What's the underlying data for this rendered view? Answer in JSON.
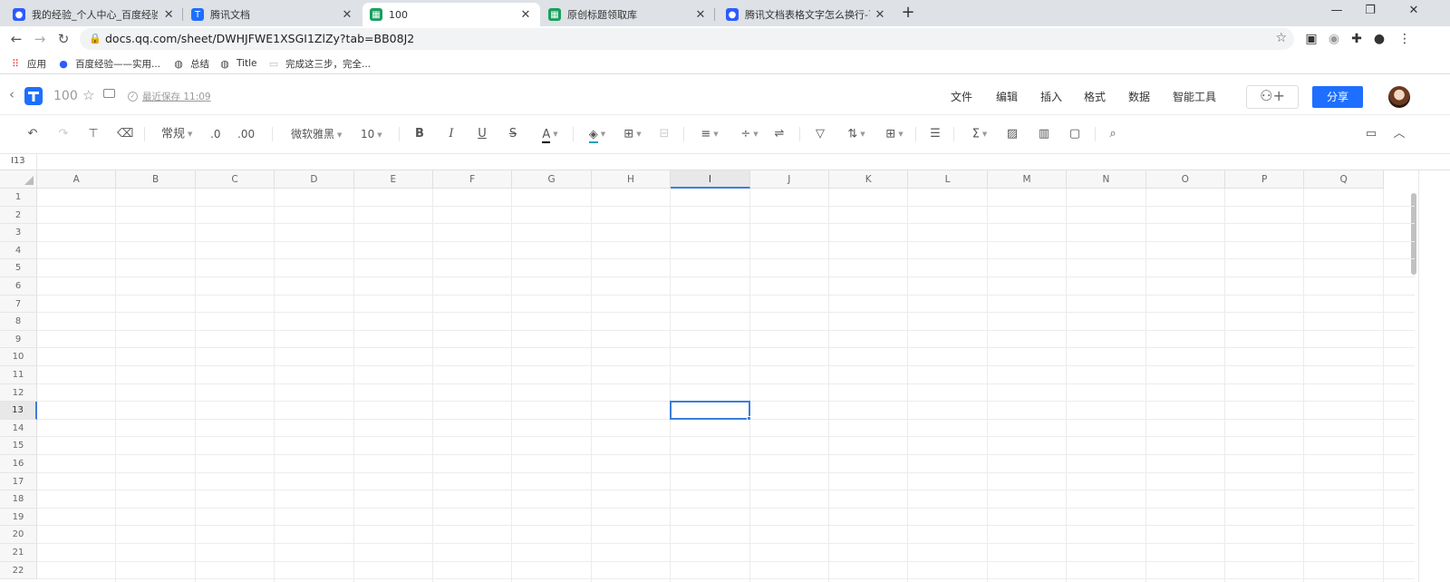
{
  "browser": {
    "tabs": [
      {
        "title": "我的经验_个人中心_百度经验",
        "icon": "baidu-paw-icon",
        "active": false
      },
      {
        "title": "腾讯文档",
        "icon": "tencent-docs-icon",
        "active": false
      },
      {
        "title": "100",
        "icon": "sheet-icon",
        "active": true
      },
      {
        "title": "原创标题领取库",
        "icon": "sheet-icon",
        "active": false
      },
      {
        "title": "腾讯文档表格文字怎么换行-百度",
        "icon": "baidu-paw-icon",
        "active": false
      }
    ],
    "new_tab_label": "+",
    "url": "docs.qq.com/sheet/DWHJFWE1XSGI1ZlZy?tab=BB08J2"
  },
  "bookmarks": [
    {
      "label": "应用",
      "icon": "apps-grid-icon"
    },
    {
      "label": "百度经验——实用...",
      "icon": "baidu-paw-icon"
    },
    {
      "label": "总结",
      "icon": "globe-icon"
    },
    {
      "label": "Title",
      "icon": "globe-icon"
    },
    {
      "label": "完成这三步，完全...",
      "icon": "page-icon"
    }
  ],
  "doc": {
    "title": "100",
    "save_status": "最近保存 11:09",
    "menu": [
      "文件",
      "编辑",
      "插入",
      "格式",
      "数据",
      "智能工具"
    ],
    "share_label": "分享"
  },
  "toolbar": {
    "number_format": "常规",
    "decimal_decrease": ".0",
    "decimal_increase": ".00",
    "font_family": "微软雅黑",
    "font_size": "10"
  },
  "formula_bar": {
    "cell_ref": "I13"
  },
  "grid": {
    "columns": [
      "A",
      "B",
      "C",
      "D",
      "E",
      "F",
      "G",
      "H",
      "I",
      "J",
      "K",
      "L",
      "M",
      "N",
      "O",
      "P",
      "Q"
    ],
    "rows": [
      "1",
      "2",
      "3",
      "4",
      "5",
      "6",
      "7",
      "8",
      "9",
      "10",
      "11",
      "12",
      "13",
      "14",
      "15",
      "16",
      "17",
      "18",
      "19",
      "20",
      "21",
      "22"
    ],
    "selected_column": "I",
    "selected_row": "13"
  },
  "colors": {
    "accent": "#1e6fff",
    "selection": "#3b7ddd",
    "header_bg": "#f7f7f7"
  }
}
